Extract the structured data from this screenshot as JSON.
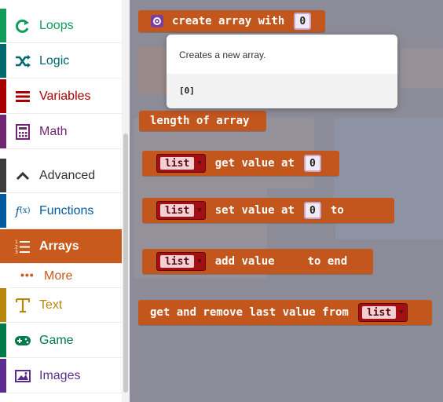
{
  "toolbox": {
    "categories": [
      {
        "label": "Loops",
        "icon": "loops-icon",
        "color": "#0f9d58"
      },
      {
        "label": "Logic",
        "icon": "logic-icon",
        "color": "#006970"
      },
      {
        "label": "Variables",
        "icon": "variables-icon",
        "color": "#a80000"
      },
      {
        "label": "Math",
        "icon": "math-icon",
        "color": "#712672"
      },
      {
        "label": "Advanced",
        "icon": "chevron-up-icon",
        "color": "#3c3c3c"
      },
      {
        "label": "Functions",
        "icon": "function-icon",
        "color": "#005a9e"
      },
      {
        "label": "Arrays",
        "icon": "arrays-icon",
        "color": "#e65722"
      },
      {
        "label": "Text",
        "icon": "text-icon",
        "color": "#b8860b"
      },
      {
        "label": "Game",
        "icon": "game-icon",
        "color": "#007a4b"
      },
      {
        "label": "Images",
        "icon": "images-icon",
        "color": "#5c2d91"
      }
    ],
    "more_label": "More",
    "selected": "Arrays"
  },
  "blocks": {
    "create_array": {
      "label": "create array with",
      "value": "0"
    },
    "length": {
      "label": "length of array"
    },
    "get_value": {
      "list": "list",
      "label": "get value at",
      "index": "0"
    },
    "set_value": {
      "list": "list",
      "label": "set value at",
      "index": "0",
      "suffix": "to"
    },
    "add_value": {
      "list": "list",
      "label": "add value",
      "suffix": "to end"
    },
    "remove_last": {
      "label": "get and remove last value from",
      "list": "list"
    }
  },
  "tooltip": {
    "description": "Creates a new array.",
    "code": "[0]"
  },
  "colors": {
    "workspace": "#8c8c99",
    "block": "#c2561d",
    "list_pill": "#a30f12",
    "selected_category": "#c75a1c"
  }
}
